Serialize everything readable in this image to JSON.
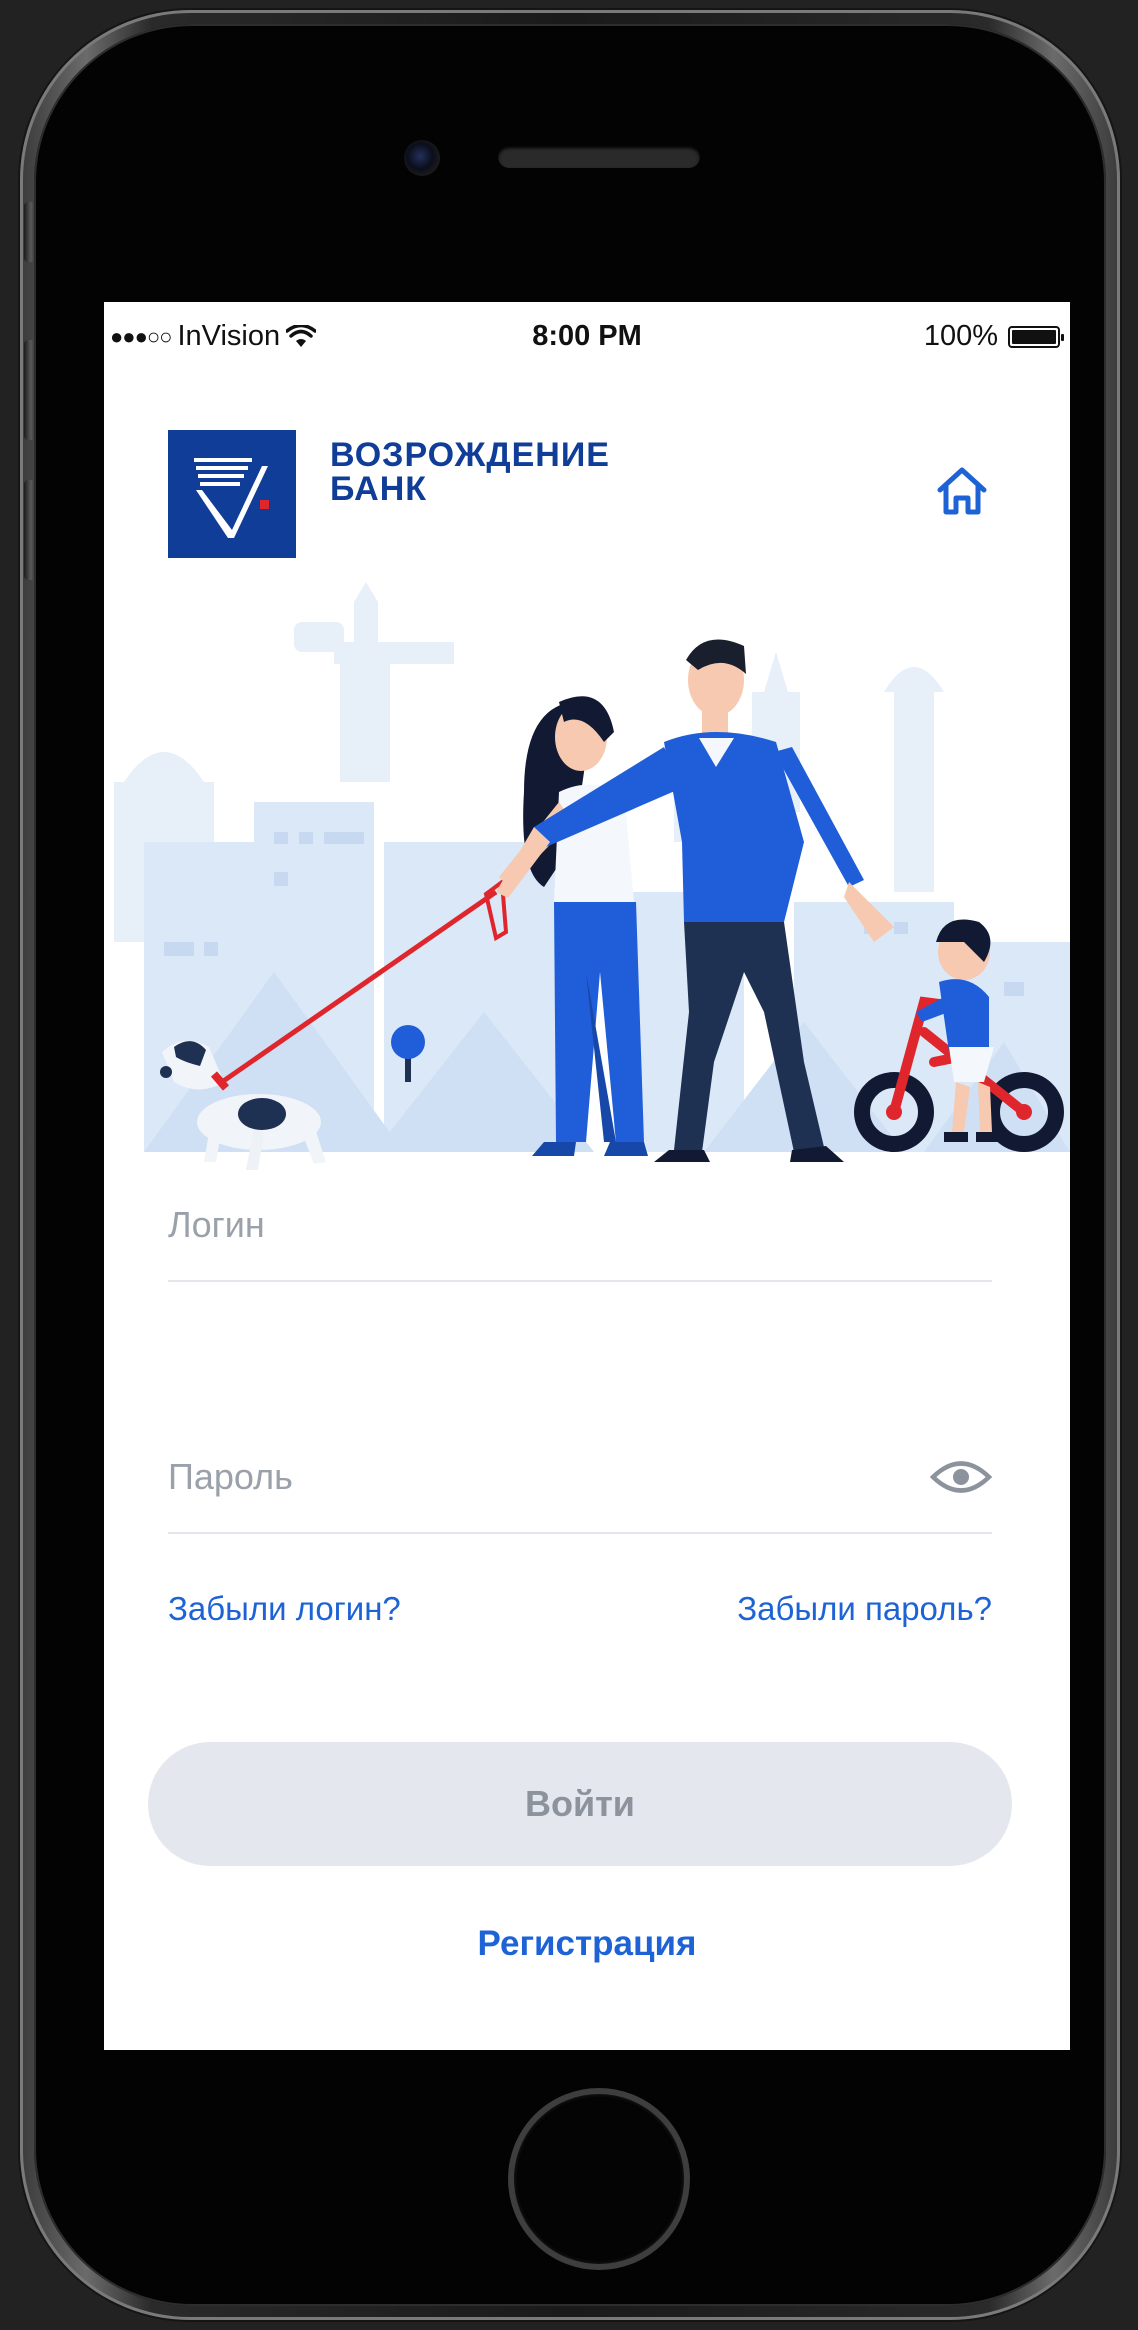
{
  "status_bar": {
    "signal_dots": "●●●○○",
    "carrier": "InVision",
    "wifi_icon": "wifi-icon",
    "time": "8:00 PM",
    "battery_percent": "100%",
    "battery_level": 1.0
  },
  "header": {
    "logo_line1": "ВОЗРОЖДЕНИЕ",
    "logo_line2": "БАНК",
    "home_icon": "home-icon"
  },
  "form": {
    "login_placeholder": "Логин",
    "password_placeholder": "Пароль",
    "eye_icon": "eye-icon"
  },
  "links": {
    "forgot_login": "Забыли логин?",
    "forgot_password": "Забыли пароль?"
  },
  "actions": {
    "login_button": "Войти",
    "register": "Регистрация"
  },
  "colors": {
    "brand_blue": "#0f3d97",
    "link_blue": "#1e63d6",
    "button_disabled_bg": "#e4e7ed",
    "button_disabled_text": "#8c939d",
    "illustration_blue": "#1f5ed8",
    "illustration_light": "#dbe8f7"
  }
}
